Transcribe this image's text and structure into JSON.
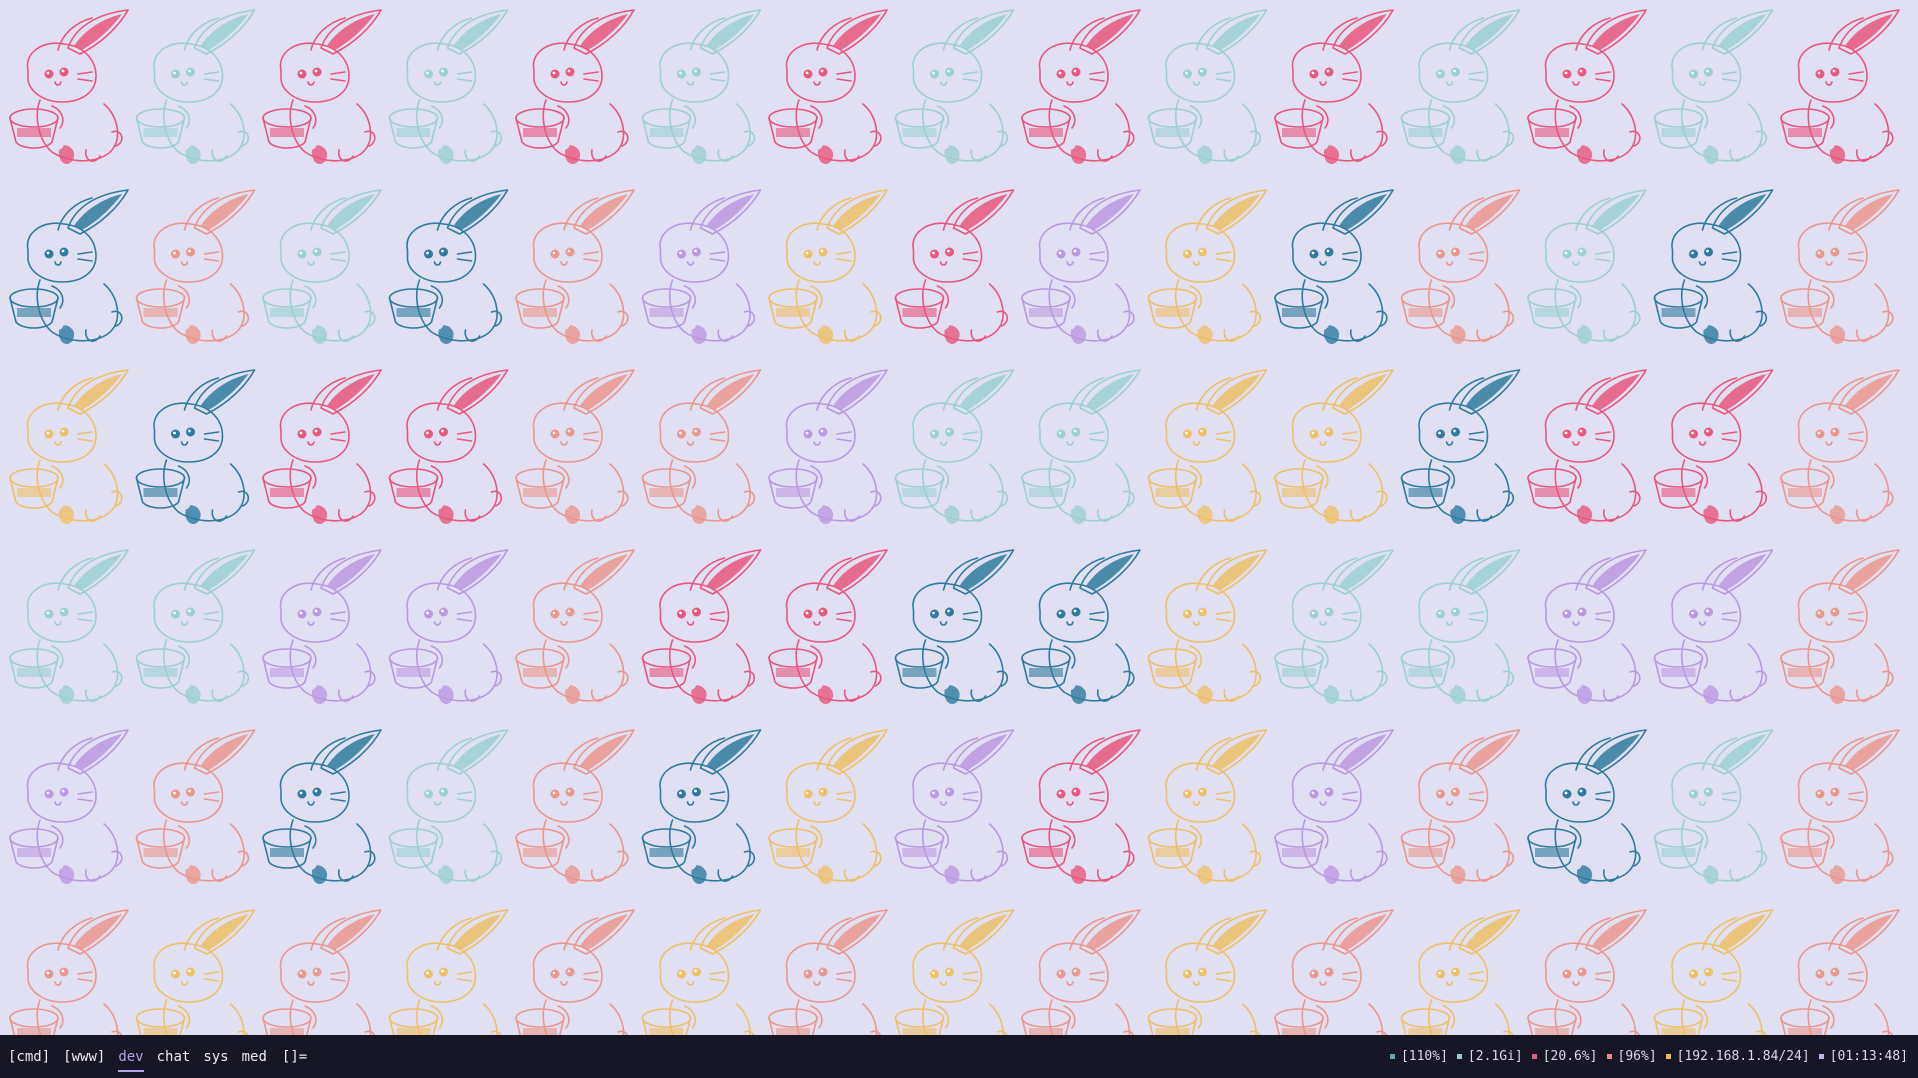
{
  "wallpaper": {
    "background": "#e1dff2",
    "motif": "rabbit-with-drum-icon",
    "palette": [
      "#e8577e",
      "#2f7b9f",
      "#f1bb50",
      "#8fcfcb",
      "#b58ce0",
      "#ec8b7d"
    ],
    "rows": 6,
    "columns": 15
  },
  "bar": {
    "workspaces": [
      {
        "label": "[cmd]",
        "active": false
      },
      {
        "label": "[www]",
        "active": false
      },
      {
        "label": "dev",
        "active": true
      },
      {
        "label": "chat",
        "active": false
      },
      {
        "label": "sys",
        "active": false
      },
      {
        "label": "med",
        "active": false
      }
    ],
    "layout": "[]=",
    "status": [
      {
        "name": "volume",
        "text": "[110%]",
        "color": "#5aa7b5"
      },
      {
        "name": "memory",
        "text": "[2.1Gi]",
        "color": "#8fcfcb"
      },
      {
        "name": "cpu",
        "text": "[20.6%]",
        "color": "#e8577e"
      },
      {
        "name": "battery",
        "text": "[96%]",
        "color": "#ec8b7d"
      },
      {
        "name": "network",
        "text": "[192.168.1.84/24]",
        "color": "#f1bb50"
      },
      {
        "name": "clock",
        "text": "[01:13:48]",
        "color": "#c0b4e8"
      }
    ]
  }
}
